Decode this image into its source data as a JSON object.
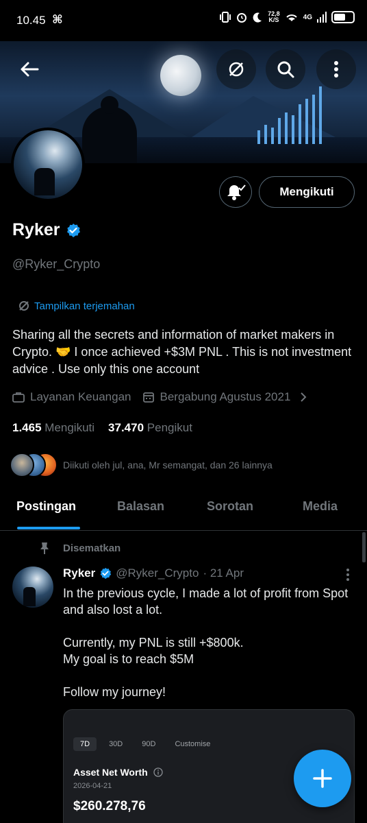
{
  "status_bar": {
    "time": "10.45",
    "network_speed": "72,8",
    "speed_unit": "K/S",
    "network_type": "4G"
  },
  "profile": {
    "name": "Ryker",
    "handle": "@Ryker_Crypto",
    "translate_label": "Tampilkan terjemahan",
    "bio": "Sharing all the secrets and information of market makers in Crypto. 🤝 I once achieved +$3M PNL . This is not investment advice . Use only this one account",
    "category": "Layanan Keuangan",
    "joined": "Bergabung Agustus 2021",
    "following_count": "1.465",
    "following_label": "Mengikuti",
    "followers_count": "37.470",
    "followers_label": "Pengikut",
    "followed_by": "Diikuti oleh jul, ana, Mr semangat, dan 26 lainnya",
    "follow_button": "Mengikuti"
  },
  "tabs": [
    "Postingan",
    "Balasan",
    "Sorotan",
    "Media"
  ],
  "post": {
    "pinned_label": "Disematkan",
    "author": "Ryker",
    "handle": "@Ryker_Crypto",
    "time": "· 21 Apr",
    "text": "In the previous cycle, I made a lot of profit from Spot and also lost a lot.\n\nCurrently, my PNL is still +$800k.\nMy goal is to reach $5M\n\nFollow my journey!",
    "card": {
      "tabs": [
        "7D",
        "30D",
        "90D",
        "Customise"
      ],
      "title": "Asset Net Worth",
      "date": "2026-04-21",
      "value": "$260.278,76"
    }
  },
  "colors": {
    "accent": "#1d9bf0",
    "background": "#000000",
    "secondary_text": "#71767b"
  }
}
